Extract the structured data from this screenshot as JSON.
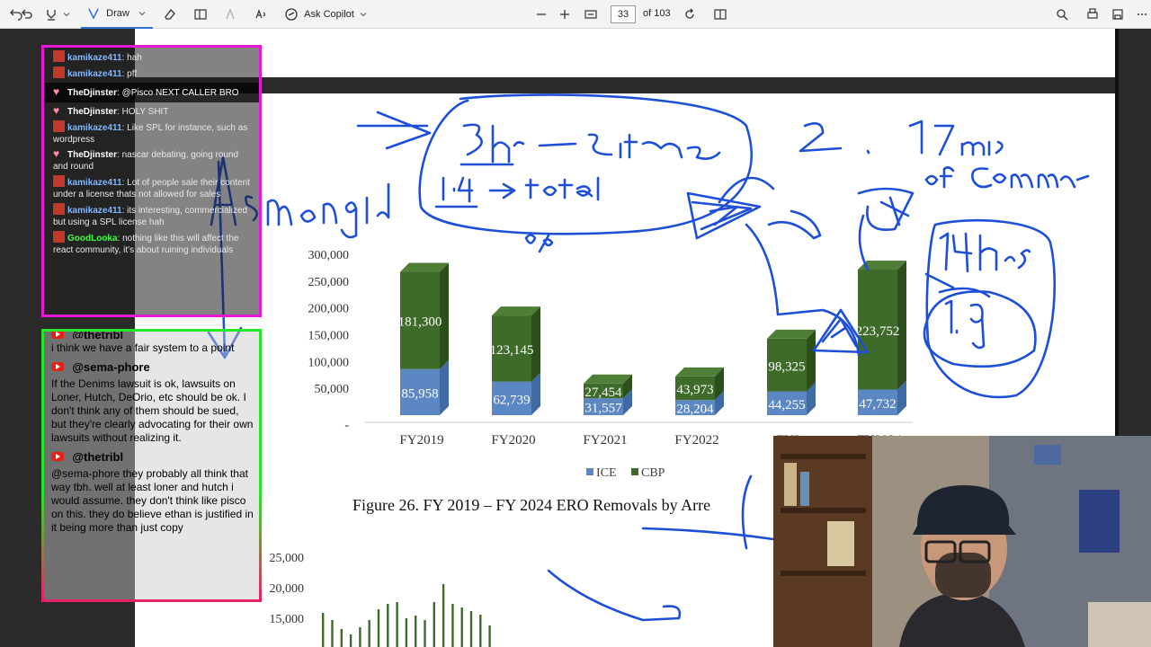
{
  "toolbar": {
    "draw_label": "Draw",
    "ask_copilot_label": "Ask Copilot",
    "page_current": "33",
    "page_total": "of 103"
  },
  "chat_top": [
    {
      "user": "kamikaze411",
      "text": "hah",
      "color": "#7fb8ff"
    },
    {
      "user": "kamikaze411",
      "text": "pff",
      "color": "#7fb8ff"
    },
    {
      "user": "TheDjinster",
      "text": "@Pisco NEXT CALLER BRO",
      "color": "#ffffff",
      "highlight": true
    },
    {
      "user": "TheDjinster",
      "text": "HOLY SHIT",
      "color": "#ffffff"
    },
    {
      "user": "kamikaze411",
      "text": "Like SPL for instance, such as wordpress",
      "color": "#7fb8ff"
    },
    {
      "user": "TheDjinster",
      "text": "nascar debating, going round and round",
      "color": "#ffffff"
    },
    {
      "user": "kamikaze411",
      "text": "Lot of people sale their content under a license thats not allowed for sales",
      "color": "#7fb8ff"
    },
    {
      "user": "kamikaze411",
      "text": "its interesting, commercialized but using a SPL license hah",
      "color": "#7fb8ff"
    },
    {
      "user": "GoodLooka",
      "text": "nothing like this will affect the react community, it's about ruining individuals",
      "color": "#3dff3d"
    }
  ],
  "chat_bottom": {
    "partial_name": "@thetribl",
    "msg1": "i think we have a fair system to a point",
    "name2": "@sema-phore",
    "msg2": "If the Denims lawsuit is ok, lawsuits on Loner, Hutch, DeOrio, etc should be ok. I don't think any of them should be sued, but they're clearly advocating for their own lawsuits without realizing it.",
    "name3": "@thetribl",
    "msg3": "@sema-phore they probably all think that way tbh. well at least loner and hutch i would assume. they don't think like pisco on this. they do believe ethan is justified in it being more than just copy"
  },
  "chart_data": {
    "type": "bar",
    "stacked": true,
    "categories": [
      "FY2019",
      "FY2020",
      "FY2021",
      "FY2022",
      "FY2023",
      "FY2024"
    ],
    "category_labels_shown": [
      "FY2019",
      "FY2020",
      "FY2021",
      "FY2022",
      "FY2",
      "FY2024"
    ],
    "series": [
      {
        "name": "ICE",
        "values": [
          85958,
          62739,
          31557,
          28204,
          44255,
          47732
        ],
        "color": "#5b87c2"
      },
      {
        "name": "CBP",
        "values": [
          181300,
          123145,
          27454,
          43973,
          98325,
          223752
        ],
        "color": "#3e6a2a"
      }
    ],
    "value_labels": {
      "ICE": [
        "85,958",
        "62,739",
        "31,557",
        "28,204",
        "44,255",
        "47,732"
      ],
      "CBP": [
        "181,300",
        "123,145",
        "27,454",
        "43,973",
        "98,325",
        "223,752"
      ]
    },
    "ylim": [
      0,
      300000
    ],
    "yticks": [
      0,
      50000,
      100000,
      150000,
      200000,
      250000,
      300000
    ],
    "ytick_labels": [
      "-",
      "50,000",
      "100,000",
      "150,000",
      "200,000",
      "250,000",
      "300,000"
    ],
    "legend": [
      "ICE",
      "CBP"
    ],
    "legend_position": "bottom"
  },
  "caption": "Figure 26. FY 2019 – FY 2024 ERO Removals by Arre",
  "second_chart": {
    "ytick_labels": [
      "25,000",
      "20,000",
      "15,000"
    ]
  },
  "ink": {
    "color": "#1d4fd8",
    "notes": [
      "3hr - 2min time",
      "1.4 -> total",
      "0%",
      "2. 17mins",
      "of Commentary",
      "14 hrs",
      "1.9",
      "Asmongold"
    ]
  }
}
